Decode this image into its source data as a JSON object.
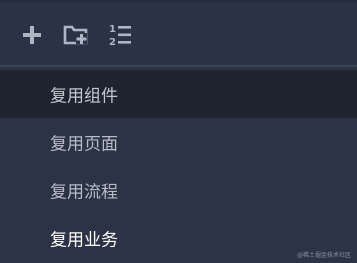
{
  "toolbar": {
    "buttons": [
      {
        "icon": "plus-icon"
      },
      {
        "icon": "folder-add-icon"
      },
      {
        "icon": "ordered-list-icon",
        "glyph_top": "1",
        "glyph_bottom": "2"
      }
    ]
  },
  "list": {
    "items": [
      {
        "label": "复用组件",
        "state": "active"
      },
      {
        "label": "复用页面",
        "state": "normal"
      },
      {
        "label": "复用流程",
        "state": "normal"
      },
      {
        "label": "复用业务",
        "state": "highlight"
      }
    ]
  },
  "watermark": "@稀土掘金技术社区",
  "colors": {
    "background": "#2b3345",
    "active_row": "#1f2430",
    "icon": "#aeb6c6",
    "text": "#b7bcc7",
    "text_highlight": "#ffffff"
  }
}
